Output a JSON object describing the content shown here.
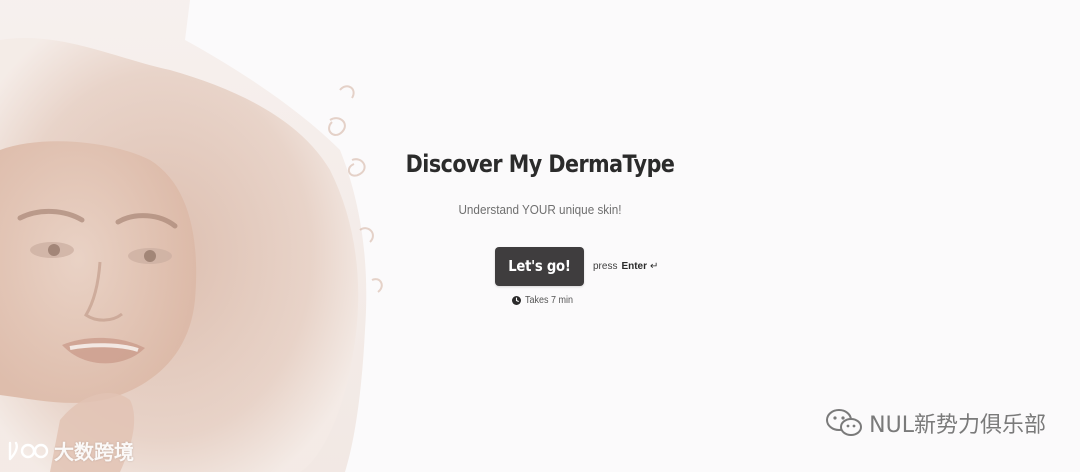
{
  "hero": {
    "image": "woman-portrait-with-curly-hair"
  },
  "content": {
    "title": "Discover My DermaType",
    "subtitle": "Understand YOUR unique skin!",
    "cta_label": "Let's go!",
    "press_prefix": "press",
    "press_key": "Enter",
    "enter_icon": "↵",
    "duration": "Takes 7 min"
  },
  "watermarks": {
    "left_text": "大数跨境",
    "right_text": "NUL新势力俱乐部"
  },
  "colors": {
    "background": "#fbfafb",
    "button": "#3f3d3e",
    "title": "#2b2b2b"
  }
}
